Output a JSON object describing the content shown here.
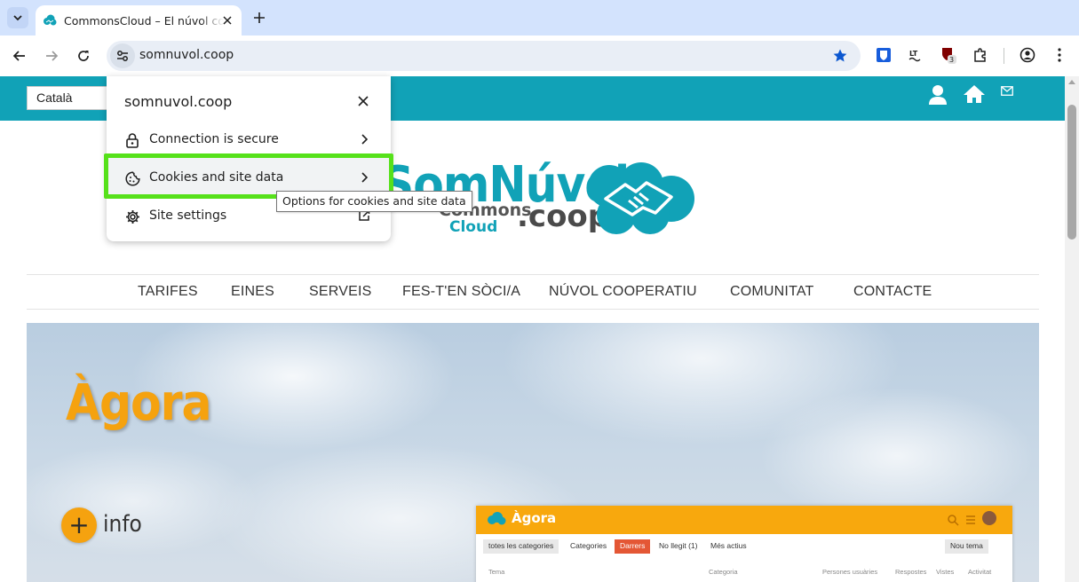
{
  "browser": {
    "tab": {
      "title": "CommonsCloud – El núvol cooperatiu"
    },
    "address": {
      "url": "somnuvol.coop"
    },
    "extensions": {
      "badge_count": "3"
    },
    "colors": {
      "tabbar": "#d3e3fd",
      "omnibox": "#e9eef6",
      "star": "#0b57d0"
    }
  },
  "site_popup": {
    "title": "somnuvol.coop",
    "rows": [
      {
        "label": "Connection is secure",
        "icon": "lock-icon"
      },
      {
        "label": "Cookies and site data",
        "icon": "cookie-icon"
      },
      {
        "label": "Site settings",
        "icon": "gear-icon"
      }
    ],
    "tooltip": "Options for cookies and site data",
    "highlight_color": "#56e11a"
  },
  "page": {
    "topbar": {
      "language": "Català",
      "color": "#11a2b7",
      "icons": [
        "user-icon",
        "home-icon",
        "mail-icon"
      ]
    },
    "logo": {
      "main_text": "SomNúvol",
      "commons": "Commons",
      "cloud": "Cloud",
      "coop": ".coop"
    },
    "nav": [
      "TARIFES",
      "EINES",
      "SERVEIS",
      "FES-T'EN SÒCI/A",
      "NÚVOL COOPERATIU",
      "COMUNITAT",
      "CONTACTE"
    ],
    "hero": {
      "title": "Àgora",
      "info_label": "info",
      "accent": "#f5a20f",
      "screenshot": {
        "logo": "Àgora",
        "filter": "totes les categories",
        "tabs": [
          "Categories",
          "Darrers",
          "No llegit (1)",
          "Més actius"
        ],
        "new_topic": "Nou tema",
        "columns": [
          "Tema",
          "Categoria",
          "Persones usuàries",
          "Respostes",
          "Vistes",
          "Activitat"
        ]
      }
    }
  }
}
